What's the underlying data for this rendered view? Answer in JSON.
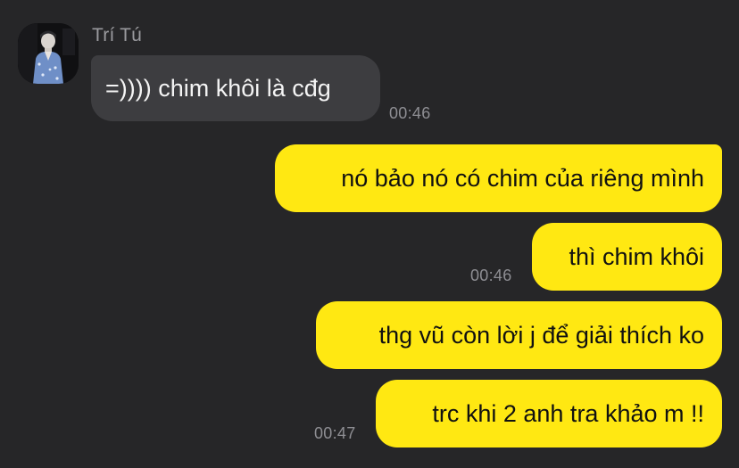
{
  "conversation": {
    "sender_name": "Trí Tú",
    "avatar_icon": "user-photo-avatar",
    "colors": {
      "background": "#262628",
      "incoming_bubble": "#3d3d40",
      "outgoing_bubble": "#ffe812",
      "timestamp": "#8e8e93"
    },
    "messages": [
      {
        "direction": "incoming",
        "text": "=)))) chim khôi là cđg",
        "time": "00:46"
      },
      {
        "direction": "outgoing",
        "text": "nó bảo nó có chim của riêng mình",
        "time": ""
      },
      {
        "direction": "outgoing",
        "text": "thì chim khôi",
        "time": "00:46"
      },
      {
        "direction": "outgoing",
        "text": "thg vũ còn lời j để giải thích ko",
        "time": ""
      },
      {
        "direction": "outgoing",
        "text": "trc khi 2 anh tra khảo m !!",
        "time": "00:47"
      }
    ]
  }
}
